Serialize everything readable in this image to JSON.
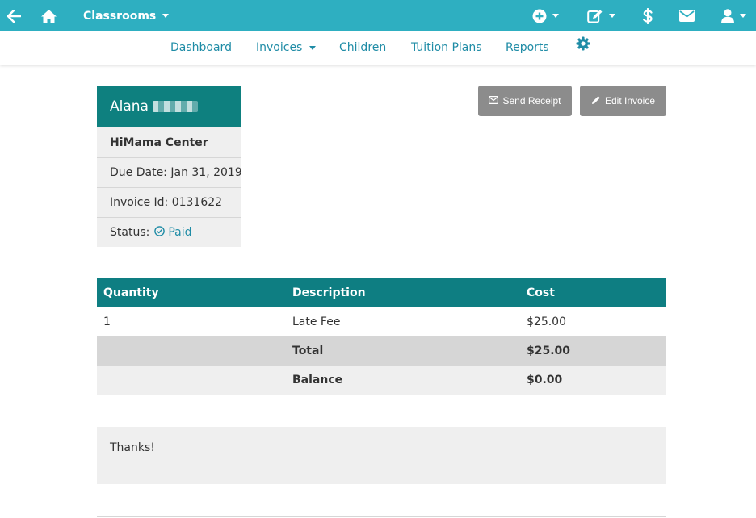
{
  "topbar": {
    "classrooms_label": "Classrooms",
    "bg_color": "#2eafc1",
    "icons": [
      "back-arrow-icon",
      "home-icon",
      "plus-circle-icon",
      "edit-icon",
      "dollar-icon",
      "envelope-icon",
      "user-icon"
    ]
  },
  "subnav": {
    "items": [
      {
        "label": "Dashboard"
      },
      {
        "label": "Invoices"
      },
      {
        "label": "Children"
      },
      {
        "label": "Tuition Plans"
      },
      {
        "label": "Reports"
      }
    ],
    "settings_icon": "gear-icon",
    "link_color": "#1f8ca6"
  },
  "invoice": {
    "name": "Alana",
    "center": "HiMama Center",
    "due_date_label": "Due Date:",
    "due_date": "Jan 31, 2019",
    "invoice_id_label": "Invoice Id:",
    "invoice_id": "0131622",
    "status_label": "Status:",
    "status": "Paid"
  },
  "actions": {
    "send_receipt": "Send Receipt",
    "edit_invoice": "Edit Invoice"
  },
  "table": {
    "headers": {
      "quantity": "Quantity",
      "description": "Description",
      "cost": "Cost"
    },
    "items": [
      {
        "quantity": "1",
        "description": "Late Fee",
        "cost": "$25.00"
      }
    ],
    "total_label": "Total",
    "total": "$25.00",
    "balance_label": "Balance",
    "balance": "$0.00",
    "header_color": "#0e7e82"
  },
  "note": "Thanks!"
}
